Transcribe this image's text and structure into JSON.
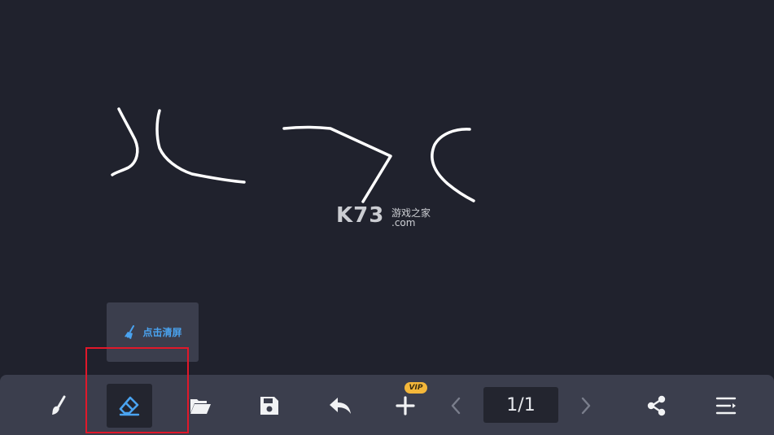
{
  "watermark": {
    "brand": "K73",
    "cn": "游戏之家",
    "domain": ".com"
  },
  "clear_popup": {
    "icon": "broom-icon",
    "label": "点击清屏"
  },
  "toolbar": {
    "tools": [
      {
        "name": "brush-tool",
        "icon": "brush-icon"
      },
      {
        "name": "eraser-tool",
        "icon": "eraser-icon",
        "active": true
      },
      {
        "name": "open-folder-tool",
        "icon": "folder-open-icon"
      },
      {
        "name": "save-tool",
        "icon": "save-icon"
      },
      {
        "name": "undo-tool",
        "icon": "undo-icon"
      },
      {
        "name": "add-page-tool",
        "icon": "plus-icon",
        "badge": "VIP"
      },
      {
        "name": "prev-page-button",
        "icon": "chevron-left-icon"
      },
      {
        "name": "next-page-button",
        "icon": "chevron-right-icon"
      },
      {
        "name": "share-tool",
        "icon": "share-icon"
      },
      {
        "name": "menu-tool",
        "icon": "menu-icon"
      }
    ],
    "page_indicator": "1/1",
    "vip_badge": "VIP"
  },
  "colors": {
    "canvas_bg": "#20222d",
    "toolbar_bg": "#3b3e4d",
    "accent": "#4aa3f0",
    "vip": "#f4b73a",
    "highlight": "#e0182a"
  }
}
